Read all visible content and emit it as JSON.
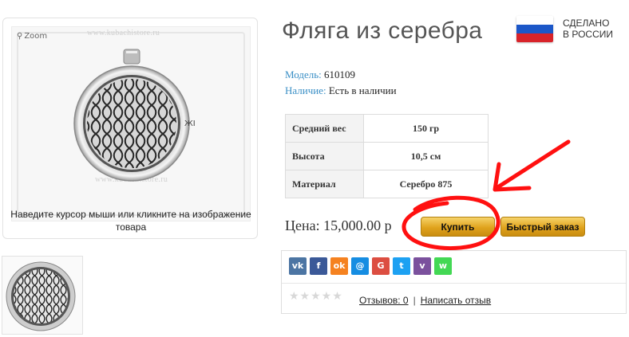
{
  "image_panel": {
    "zoom_label": "Zoom",
    "watermark": "www.kubachistore.ru",
    "hint": "Наведите курсор мыши или кликните на изображение товара"
  },
  "product": {
    "title": "Фляга из серебра",
    "model_label": "Модель:",
    "model_value": "610109",
    "stock_label": "Наличие:",
    "stock_value": "Есть в наличии"
  },
  "made_in": {
    "line1": "СДЕЛАНО",
    "line2": "В РОССИИ",
    "flag_colors": [
      "#ffffff",
      "#1c57c8",
      "#d8232a"
    ]
  },
  "specs": [
    {
      "label": "Средний вес",
      "value": "150 гр"
    },
    {
      "label": "Высота",
      "value": "10,5 см"
    },
    {
      "label": "Материал",
      "value": "Серебро 875"
    }
  ],
  "purchase": {
    "price": "Цена: 15,000.00 р",
    "buy_label": "Купить",
    "quick_order_label": "Быстрый заказ"
  },
  "share": {
    "icons": [
      {
        "name": "vk-icon",
        "glyph": "vk",
        "color": "#4c75a3"
      },
      {
        "name": "facebook-icon",
        "glyph": "f",
        "color": "#3b5998"
      },
      {
        "name": "odnoklassniki-icon",
        "glyph": "ok",
        "color": "#f58220"
      },
      {
        "name": "moimir-icon",
        "glyph": "@",
        "color": "#168de2"
      },
      {
        "name": "googleplus-icon",
        "glyph": "G",
        "color": "#dc4e41"
      },
      {
        "name": "twitter-icon",
        "glyph": "t",
        "color": "#1da1f2"
      },
      {
        "name": "viber-icon",
        "glyph": "v",
        "color": "#7b519d"
      },
      {
        "name": "whatsapp-icon",
        "glyph": "w",
        "color": "#43d854"
      }
    ]
  },
  "reviews": {
    "stars": "★★★★★",
    "rating": 0,
    "reviews_link": "Отзывов: 0",
    "separator": "|",
    "write_review": "Написать отзыв"
  },
  "annotation_color": "#ff1010"
}
